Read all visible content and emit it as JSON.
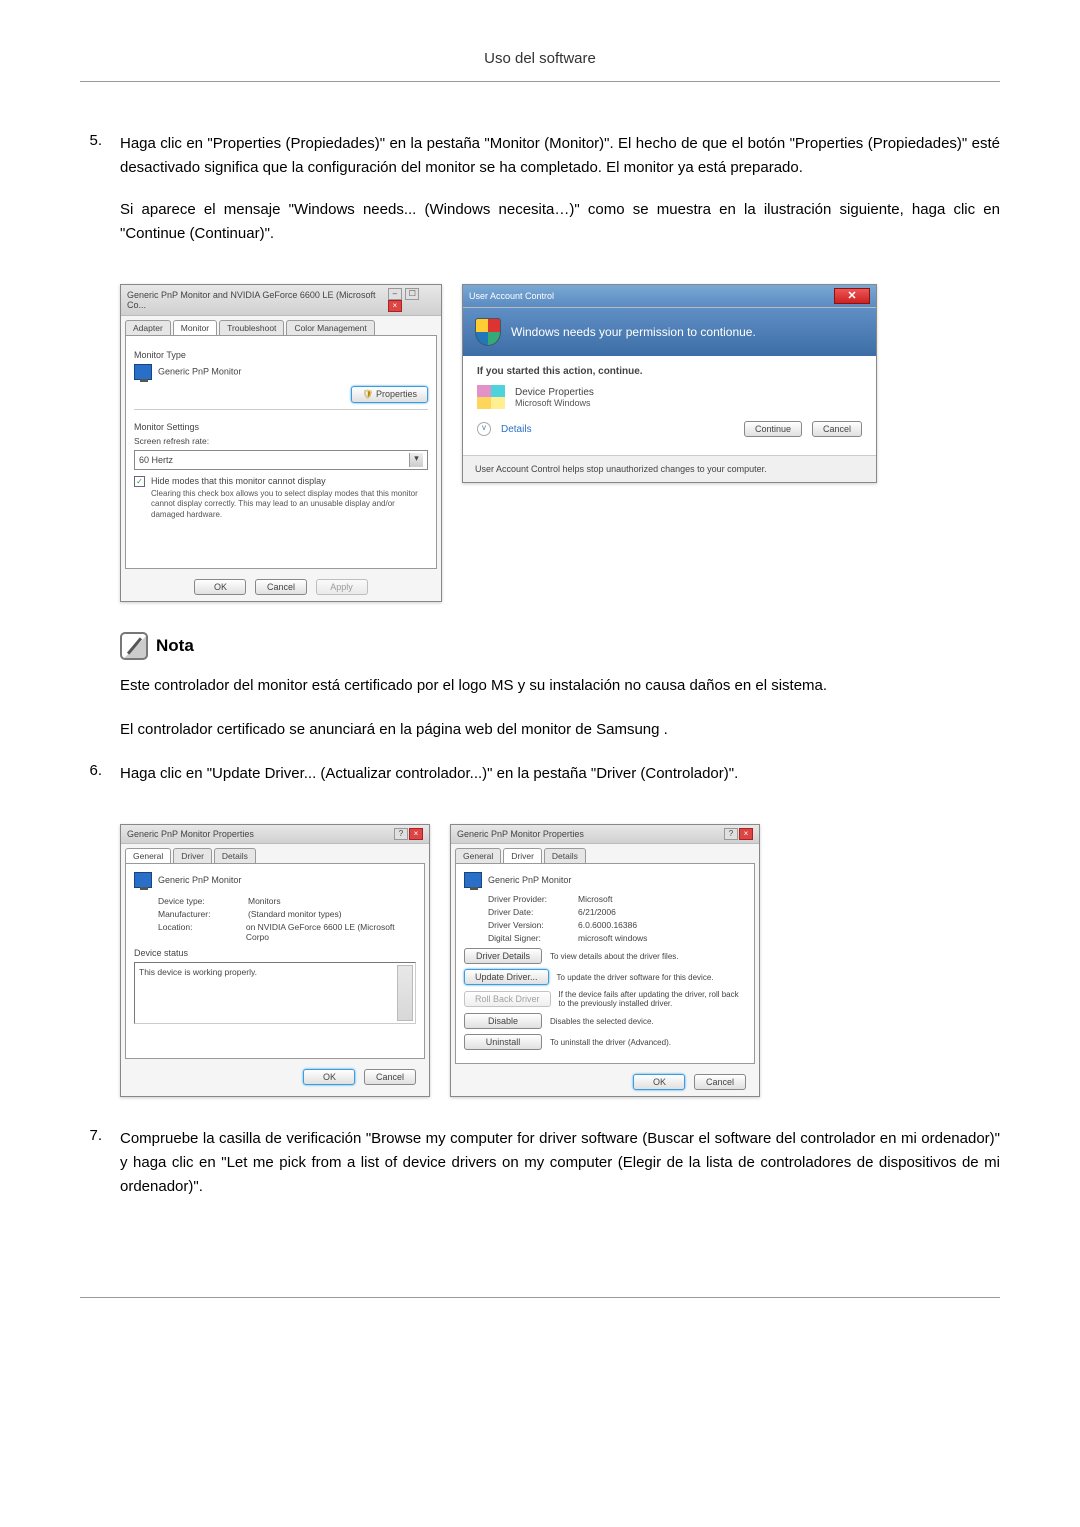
{
  "pageHeader": "Uso del software",
  "step5": {
    "num": "5.",
    "p1": "Haga clic en \"Properties (Propiedades)\" en la pestaña \"Monitor (Monitor)\". El hecho de que el botón \"Properties (Propiedades)\" esté desactivado significa que la configuración del monitor se ha completado. El monitor ya está preparado.",
    "p2": "Si aparece el mensaje \"Windows needs... (Windows necesita…)\" como se muestra en la ilustración siguiente, haga clic en \"Continue (Continuar)\"."
  },
  "dialog1": {
    "title": "Generic PnP Monitor and NVIDIA GeForce 6600 LE (Microsoft Co...",
    "tabs": [
      "Adapter",
      "Monitor",
      "Troubleshoot",
      "Color Management"
    ],
    "monitorTypeLabel": "Monitor Type",
    "monitorName": "Generic PnP Monitor",
    "propertiesBtn": "Properties",
    "monitorSettings": "Monitor Settings",
    "refreshLabel": "Screen refresh rate:",
    "refreshValue": "60 Hertz",
    "hideModes": "Hide modes that this monitor cannot display",
    "hideNote": "Clearing this check box allows you to select display modes that this monitor cannot display correctly. This may lead to an unusable display and/or damaged hardware.",
    "ok": "OK",
    "cancel": "Cancel",
    "apply": "Apply"
  },
  "uac": {
    "title": "User Account Control",
    "headline": "Windows needs your permission to contionue.",
    "started": "If you started this action, continue.",
    "appName": "Device Properties",
    "publisher": "Microsoft Windows",
    "details": "Details",
    "continue": "Continue",
    "cancel": "Cancel",
    "footer": "User Account Control helps stop unauthorized changes to your computer."
  },
  "note": {
    "label": "Nota",
    "p1": "Este controlador del monitor está certificado por el logo MS y su instalación no causa daños en el sistema.",
    "p2": "El controlador certificado se anunciará en la página web del monitor de Samsung ."
  },
  "step6": {
    "num": "6.",
    "p1": "Haga clic en \"Update Driver... (Actualizar controlador...)\" en la pestaña \"Driver (Controlador)\"."
  },
  "propsGeneral": {
    "title": "Generic PnP Monitor Properties",
    "tabs": [
      "General",
      "Driver",
      "Details"
    ],
    "name": "Generic PnP Monitor",
    "deviceType_k": "Device type:",
    "deviceType_v": "Monitors",
    "manufacturer_k": "Manufacturer:",
    "manufacturer_v": "(Standard monitor types)",
    "location_k": "Location:",
    "location_v": "on NVIDIA GeForce 6600 LE (Microsoft Corpo",
    "statusLabel": "Device status",
    "statusText": "This device is working properly.",
    "ok": "OK",
    "cancel": "Cancel"
  },
  "propsDriver": {
    "title": "Generic PnP Monitor Properties",
    "tabs": [
      "General",
      "Driver",
      "Details"
    ],
    "name": "Generic PnP Monitor",
    "provider_k": "Driver Provider:",
    "provider_v": "Microsoft",
    "date_k": "Driver Date:",
    "date_v": "6/21/2006",
    "version_k": "Driver Version:",
    "version_v": "6.0.6000.16386",
    "signer_k": "Digital Signer:",
    "signer_v": "microsoft windows",
    "btnDetails": "Driver Details",
    "descDetails": "To view details about the driver files.",
    "btnUpdate": "Update Driver...",
    "descUpdate": "To update the driver software for this device.",
    "btnRollback": "Roll Back Driver",
    "descRollback": "If the device fails after updating the driver, roll back to the previously installed driver.",
    "btnDisable": "Disable",
    "descDisable": "Disables the selected device.",
    "btnUninstall": "Uninstall",
    "descUninstall": "To uninstall the driver (Advanced).",
    "ok": "OK",
    "cancel": "Cancel"
  },
  "step7": {
    "num": "7.",
    "p1": "Compruebe la casilla de verificación \"Browse my computer for driver software (Buscar el software del controlador en mi ordenador)\" y haga clic en \"Let me pick from a list of device drivers on my computer (Elegir de la lista de controladores de dispositivos de mi ordenador)\"."
  }
}
